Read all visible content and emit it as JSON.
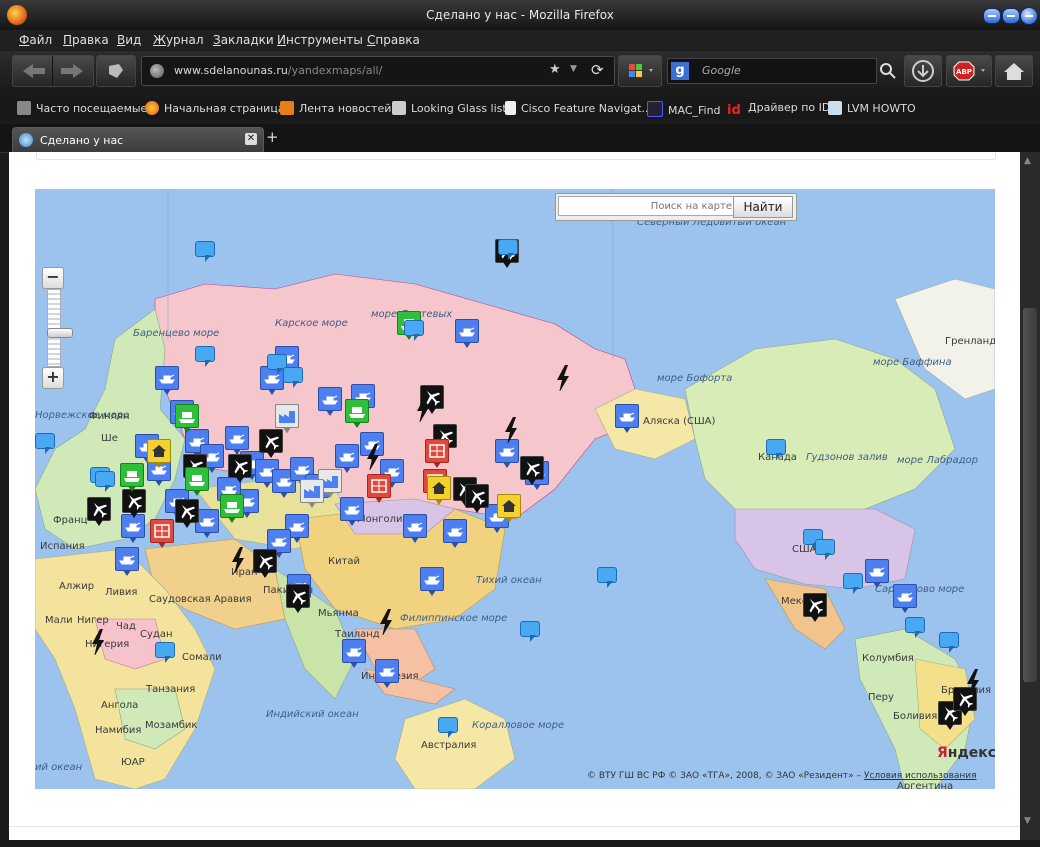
{
  "window": {
    "title": "Сделано у нас - Mozilla Firefox"
  },
  "menu": [
    "Файл",
    "Правка",
    "Вид",
    "Журнал",
    "Закладки",
    "Инструменты",
    "Справка"
  ],
  "address": {
    "domain": "www.sdelanounas.ru",
    "path": "/yandexmaps/all/"
  },
  "search": {
    "placeholder": "Google"
  },
  "bookmarks": [
    "Часто посещаемые",
    "Начальная страница",
    "Лента новостей",
    "Looking Glass list",
    "Cisco Feature Navigat...",
    "MAC_Find",
    "Драйвер по ID",
    "LVM HOWTO"
  ],
  "tab": {
    "label": "Сделано у нас",
    "close": "✕",
    "new": "+"
  },
  "map": {
    "search_placeholder": "Поиск на карте",
    "search_button": "Найти",
    "zoom_in": "+",
    "zoom_out": "−",
    "logo_red": "Я",
    "logo_rest": "ндекс",
    "copyright": "© ВТУ ГШ ВС РФ © ЗАО «ТГА», 2008, © ЗАО «Резидент» –",
    "terms": "Условия использования",
    "seas": [
      "Северный Ледовитый океан",
      "Баренцево море",
      "Карское море",
      "море Лаптевых",
      "Норвежское море",
      "Тихий океан",
      "Индийский океан",
      "Филиппинское море",
      "Коралловое море",
      "море Бофорта",
      "море Баффина",
      "Гудзонов залив",
      "море Лабрадор",
      "Саргассово море",
      "Гренландия",
      "ий океан"
    ],
    "lands": [
      "Финлян",
      "Франц",
      "Испания",
      "Алжир",
      "Ливия",
      "Саудовская Аравия",
      "Мали",
      "Нигер",
      "Чад",
      "Судан",
      "Сомали",
      "Нигерия",
      "Танзания",
      "Ангола",
      "Мозамбик",
      "Намибия",
      "ЮАР",
      "Китай",
      "Монголия",
      "Пакистан",
      "Мьянма",
      "Таиланд",
      "Индонезия",
      "Австралия",
      "Иран",
      "Аляска (США)",
      "Канада",
      "США",
      "Мексика",
      "Колумбия",
      "Перу",
      "Боливия",
      "Бразилия",
      "Аргентина",
      "Ше"
    ]
  }
}
